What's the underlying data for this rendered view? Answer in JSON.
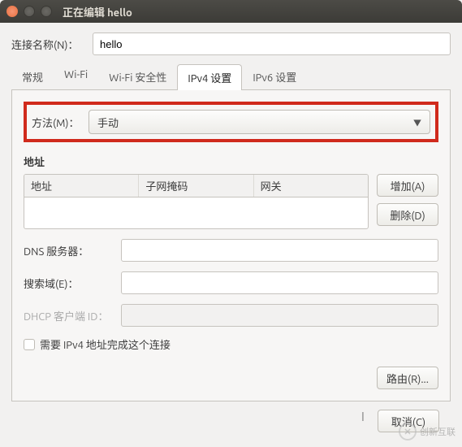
{
  "window": {
    "title": "正在编辑 hello"
  },
  "connection": {
    "label": "连接名称(N)：",
    "value": "hello"
  },
  "tabs": {
    "general": "常规",
    "wifi": "Wi-Fi",
    "wifi_sec": "Wi-Fi 安全性",
    "ipv4": "IPv4 设置",
    "ipv6": "IPv6 设置"
  },
  "method": {
    "label": "方法(M)：",
    "value": "手动"
  },
  "addr": {
    "section": "地址",
    "cols": {
      "address": "地址",
      "netmask": "子网掩码",
      "gateway": "网关"
    },
    "add": "增加(A)",
    "delete": "删除(D)"
  },
  "dns": {
    "label": "DNS 服务器：",
    "value": ""
  },
  "search": {
    "label": "搜索域(E)：",
    "value": ""
  },
  "dhcp": {
    "label": "DHCP 客户端 ID：",
    "value": ""
  },
  "require": {
    "label": "需要 IPv4 地址完成这个连接"
  },
  "routes": {
    "label": "路由(R)..."
  },
  "footer": {
    "cancel": "取消(C)"
  },
  "logo": {
    "text": "创新互联"
  }
}
